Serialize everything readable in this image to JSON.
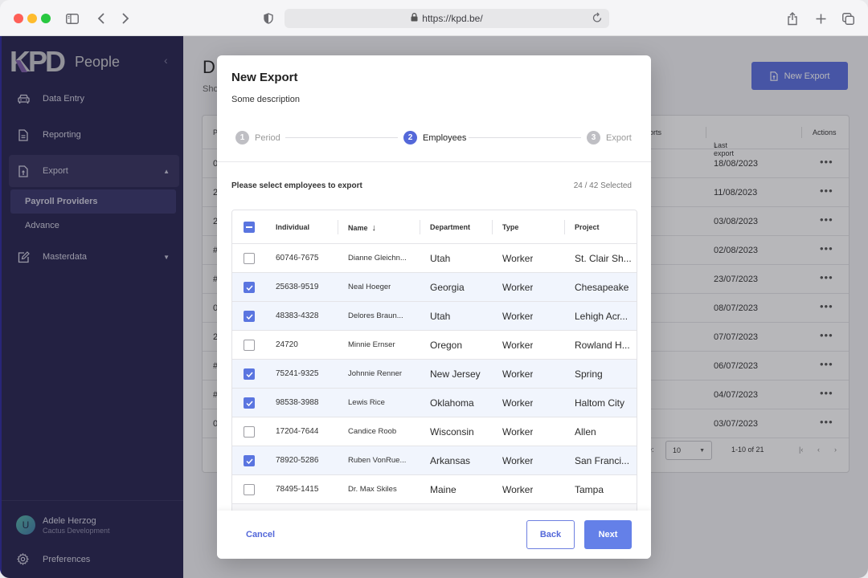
{
  "browser": {
    "url": "https://kpd.be/",
    "icons": [
      "sidebar-toggle-icon",
      "back-icon",
      "forward-icon",
      "shield-icon",
      "lock-icon",
      "reload-icon",
      "share-icon",
      "new-tab-icon",
      "tabs-overview-icon"
    ]
  },
  "sidebar": {
    "logo": "KPD",
    "app_name": "People",
    "items": [
      {
        "label": "Data Entry",
        "icon": "car-icon"
      },
      {
        "label": "Reporting",
        "icon": "document-icon"
      },
      {
        "label": "Export",
        "icon": "file-upload-icon",
        "expanded": true
      },
      {
        "label": "Masterdata",
        "icon": "edit-icon",
        "expanded": false
      }
    ],
    "export_subitems": [
      {
        "label": "Payroll Providers",
        "active": true
      },
      {
        "label": "Advance",
        "active": false
      }
    ],
    "user": {
      "initial": "U",
      "name": "Adele Herzog",
      "org": "Cactus Development"
    },
    "preferences_label": "Preferences"
  },
  "page": {
    "title_partial": "D",
    "subtitle_partial": "Sho",
    "new_export_label": "New Export",
    "table": {
      "headers": {
        "first_partial": "P",
        "exports_partial": "ports",
        "last_export": "Last export",
        "actions": "Actions"
      },
      "rows": [
        {
          "first": "0",
          "last_export": "18/08/2023"
        },
        {
          "first": "2",
          "last_export": "11/08/2023"
        },
        {
          "first": "2",
          "last_export": "03/08/2023"
        },
        {
          "first": "#",
          "last_export": "02/08/2023"
        },
        {
          "first": "#",
          "last_export": "23/07/2023"
        },
        {
          "first": "0",
          "last_export": "08/07/2023"
        },
        {
          "first": "2",
          "last_export": "07/07/2023"
        },
        {
          "first": "#",
          "last_export": "06/07/2023"
        },
        {
          "first": "#",
          "last_export": "04/07/2023"
        },
        {
          "first": "0",
          "last_export": "03/07/2023"
        }
      ],
      "actions_glyph": "•••",
      "footer": {
        "rows_per_page_partial": "ge:",
        "rows_per_page": "10",
        "range": "1-10 of 21"
      }
    }
  },
  "modal": {
    "title": "New Export",
    "description": "Some description",
    "steps": [
      {
        "number": "1",
        "label": "Period",
        "state": "done"
      },
      {
        "number": "2",
        "label": "Employees",
        "state": "active"
      },
      {
        "number": "3",
        "label": "Export",
        "state": "pending"
      }
    ],
    "prompt": "Please select employees to export",
    "selected_count": "24 / 42 Selected",
    "columns": [
      "Individual",
      "Name",
      "Department",
      "Type",
      "Project"
    ],
    "sort_column": "Name",
    "employees": [
      {
        "individual": "60746-7675",
        "name": "Dianne Gleichn...",
        "department": "Utah",
        "type": "Worker",
        "project": "St. Clair Sh...",
        "selected": false
      },
      {
        "individual": "25638-9519",
        "name": "Neal Hoeger",
        "department": "Georgia",
        "type": "Worker",
        "project": "Chesapeake",
        "selected": true
      },
      {
        "individual": "48383-4328",
        "name": "Delores Braun...",
        "department": "Utah",
        "type": "Worker",
        "project": "Lehigh Acr...",
        "selected": true
      },
      {
        "individual": "24720",
        "name": "Minnie Ernser",
        "department": "Oregon",
        "type": "Worker",
        "project": "Rowland H...",
        "selected": false
      },
      {
        "individual": "75241-9325",
        "name": "Johnnie Renner",
        "department": "New Jersey",
        "type": "Worker",
        "project": "Spring",
        "selected": true
      },
      {
        "individual": "98538-3988",
        "name": "Lewis Rice",
        "department": "Oklahoma",
        "type": "Worker",
        "project": "Haltom City",
        "selected": true
      },
      {
        "individual": "17204-7644",
        "name": "Candice Roob",
        "department": "Wisconsin",
        "type": "Worker",
        "project": "Allen",
        "selected": false
      },
      {
        "individual": "78920-5286",
        "name": "Ruben VonRue...",
        "department": "Arkansas",
        "type": "Worker",
        "project": "San Franci...",
        "selected": true
      },
      {
        "individual": "78495-1415",
        "name": "Dr. Max Skiles",
        "department": "Maine",
        "type": "Worker",
        "project": "Tampa",
        "selected": false
      }
    ],
    "cancel_label": "Cancel",
    "back_label": "Back",
    "next_label": "Next"
  },
  "colors": {
    "sidebar_bg": "#26234e",
    "accent": "#5468d9",
    "selected_row": "#f1f5fd",
    "checkbox": "#5a75e0"
  }
}
